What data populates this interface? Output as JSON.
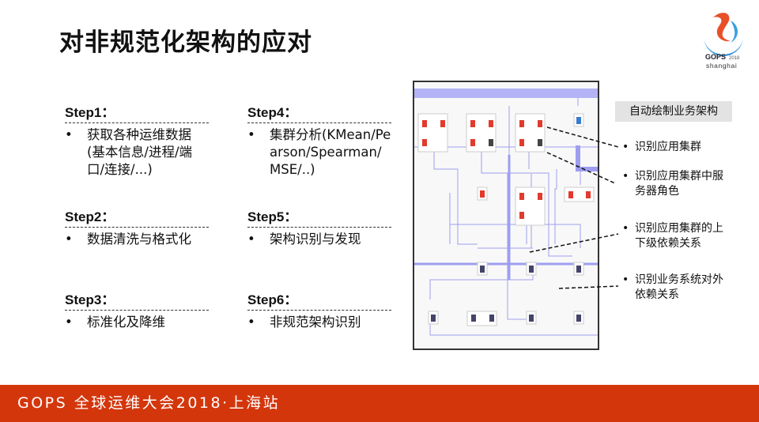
{
  "title": "对非规范化架构的应对",
  "logo": {
    "brand": "GOPS",
    "year": "2018",
    "city": "shanghai"
  },
  "steps": [
    {
      "heading": "Step1：",
      "items": [
        "获取各种运维数据(基本信息/进程/端口/连接/...)"
      ]
    },
    {
      "heading": "Step2：",
      "items": [
        "数据清洗与格式化"
      ]
    },
    {
      "heading": "Step3：",
      "items": [
        "标准化及降维"
      ]
    },
    {
      "heading": "Step4：",
      "items": [
        "集群分析(KMean/Pearson/Spearman/MSE/..)"
      ]
    },
    {
      "heading": "Step5：",
      "items": [
        "架构识别与发现"
      ]
    },
    {
      "heading": "Step6：",
      "items": [
        "非规范架构识别"
      ]
    }
  ],
  "diagram": {
    "tag": "自动绘制业务架构",
    "callouts": [
      "识别应用集群",
      "识别应用集群中服务器角色",
      "识别应用集群的上下级依赖关系",
      "识别业务系统对外依赖关系"
    ],
    "colors": {
      "link": "#8f8ff0",
      "node_red": "#e23a2c",
      "node_blue": "#3a7bd0",
      "node_dark": "#44446a"
    }
  },
  "footer": {
    "text": "GOPS 全球运维大会2018·上海站",
    "color": "#d4360c"
  }
}
